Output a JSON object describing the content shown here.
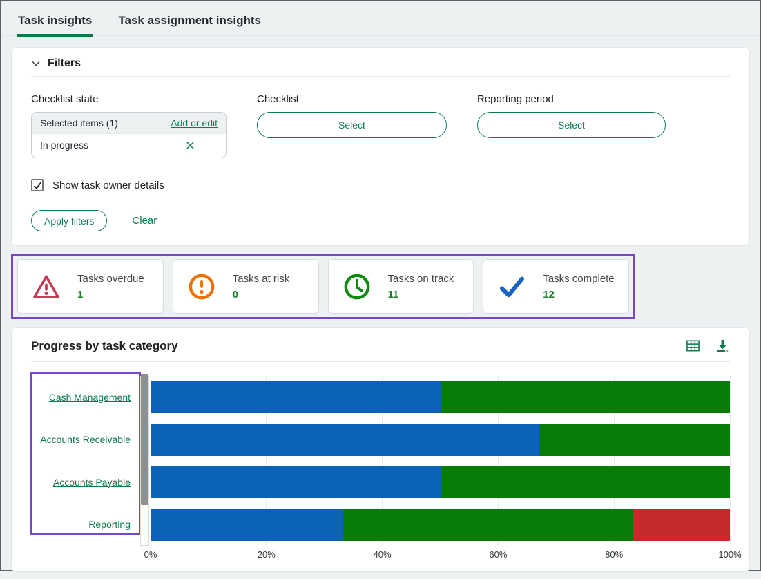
{
  "page": {
    "background": "#edf1f2",
    "accent_green": "#0e7b4e",
    "annotation_purple": "#7448c8"
  },
  "tabs": [
    {
      "label": "Task insights",
      "active": true
    },
    {
      "label": "Task assignment insights",
      "active": false
    }
  ],
  "filters": {
    "title": "Filters",
    "checklist_state": {
      "label": "Checklist state",
      "selected_items_text": "Selected items (1)",
      "add_or_edit_label": "Add or edit",
      "chip": "In progress"
    },
    "checklist": {
      "label": "Checklist",
      "button_label": "Select"
    },
    "reporting_period": {
      "label": "Reporting period",
      "button_label": "Select"
    },
    "show_owner_checkbox": {
      "label": "Show task owner details",
      "checked": true
    },
    "apply_button_label": "Apply filters",
    "clear_link_label": "Clear"
  },
  "summary_cards": [
    {
      "label": "Tasks overdue",
      "value": "1",
      "icon": "warning-triangle-icon",
      "color": "#c73a52"
    },
    {
      "label": "Tasks at risk",
      "value": "0",
      "icon": "exclamation-circle-icon",
      "color": "#ee7000"
    },
    {
      "label": "Tasks on track",
      "value": "11",
      "icon": "clock-icon",
      "color": "#0e8c0e"
    },
    {
      "label": "Tasks complete",
      "value": "12",
      "icon": "check-icon",
      "color": "#1a63c6"
    }
  ],
  "chart_panel": {
    "title": "Progress by task category",
    "icons": [
      "table-icon",
      "download-icon"
    ]
  },
  "chart_data": {
    "type": "bar",
    "orientation": "horizontal",
    "stacked": true,
    "unit": "percent",
    "categories": [
      "Cash Management",
      "Accounts Receivable",
      "Accounts Payable",
      "Reporting"
    ],
    "series": [
      {
        "name": "blue-segment",
        "color": "#0b62b6",
        "values": [
          50,
          67,
          50,
          33.3
        ]
      },
      {
        "name": "green-segment",
        "color": "#077d07",
        "values": [
          50,
          33,
          50,
          50
        ]
      },
      {
        "name": "red-segment",
        "color": "#c62b2b",
        "values": [
          0,
          0,
          0,
          16.7
        ]
      }
    ],
    "x_ticks": [
      "0%",
      "20%",
      "40%",
      "60%",
      "80%",
      "100%"
    ],
    "xlim": [
      0,
      100
    ],
    "grid": true,
    "legend": false,
    "scrollbar": {
      "visible": true,
      "thumb_fraction": 0.78
    }
  }
}
